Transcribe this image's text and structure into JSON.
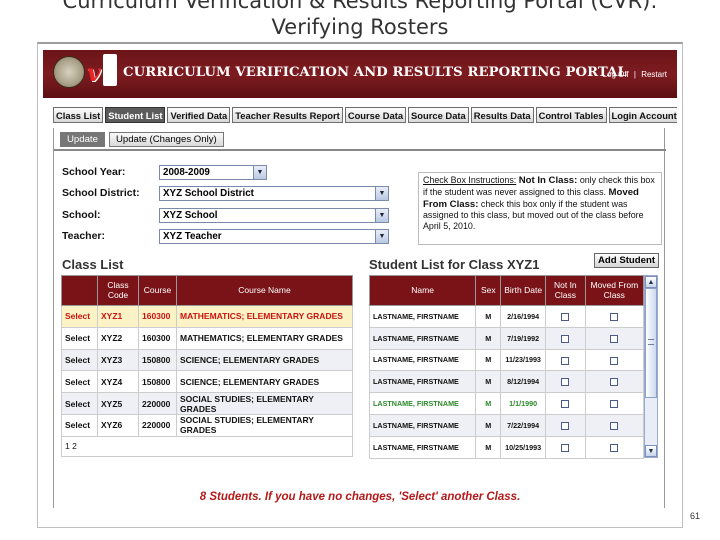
{
  "slide": {
    "title_line1": "Curriculum Verification & Results Reporting Portal (CVR):",
    "title_line2": "Verifying Rosters",
    "page_number": "61"
  },
  "banner": {
    "title": "CURRICULUM VERIFICATION AND RESULTS REPORTING PORTAL",
    "logout": "Log Off",
    "separator": "|",
    "restart": "Restart",
    "logo_icon": "vi-logo-icon",
    "seal_icon": "state-seal-icon"
  },
  "nav_tabs": [
    {
      "label": "Class List",
      "active": false
    },
    {
      "label": "Student List",
      "active": true
    },
    {
      "label": "Verified Data",
      "active": false
    },
    {
      "label": "Teacher Results Report",
      "active": false
    },
    {
      "label": "Course Data",
      "active": false
    },
    {
      "label": "Source Data",
      "active": false
    },
    {
      "label": "Results Data",
      "active": false
    },
    {
      "label": "Control Tables",
      "active": false
    },
    {
      "label": "Login Account",
      "active": false
    }
  ],
  "sub_tabs": [
    {
      "label": "Update",
      "active": true
    },
    {
      "label": "Update (Changes Only)",
      "active": false
    }
  ],
  "filters": {
    "school_year_label": "School Year:",
    "school_year_value": "2008-2009",
    "district_label": "School District:",
    "district_value": "XYZ School District",
    "school_label": "School:",
    "school_value": "XYZ School",
    "teacher_label": "Teacher:",
    "teacher_value": "XYZ Teacher"
  },
  "instructions": {
    "heading": "Check Box Instructions:",
    "not_in_class_term": "Not In Class:",
    "not_in_class_text": "only check this box if the student was never assigned to this class.",
    "moved_term": "Moved From Class:",
    "moved_text": "check this box only if the student was assigned to this class, but moved out of the class before April 5, 2010."
  },
  "class_list": {
    "title": "Class List",
    "columns": [
      "",
      "Class Code",
      "Course",
      "Course Name"
    ],
    "rows": [
      {
        "action": "Select",
        "code": "XYZ1",
        "course": "160300",
        "name": "MATHEMATICS; ELEMENTARY GRADES"
      },
      {
        "action": "Select",
        "code": "XYZ2",
        "course": "160300",
        "name": "MATHEMATICS; ELEMENTARY GRADES"
      },
      {
        "action": "Select",
        "code": "XYZ3",
        "course": "150800",
        "name": "SCIENCE; ELEMENTARY GRADES"
      },
      {
        "action": "Select",
        "code": "XYZ4",
        "course": "150800",
        "name": "SCIENCE; ELEMENTARY GRADES"
      },
      {
        "action": "Select",
        "code": "XYZ5",
        "course": "220000",
        "name": "SOCIAL STUDIES; ELEMENTARY GRADES"
      },
      {
        "action": "Select",
        "code": "XYZ6",
        "course": "220000",
        "name": "SOCIAL STUDIES; ELEMENTARY GRADES"
      }
    ],
    "pager": [
      "1",
      "2"
    ]
  },
  "student_list": {
    "title": "Student List for Class XYZ1",
    "add_button": "Add Student",
    "columns": [
      "Name",
      "Sex",
      "Birth Date",
      "Not In Class",
      "Moved From Class"
    ],
    "rows": [
      {
        "name": "LASTNAME, FIRSTNAME",
        "sex": "M",
        "birth": "2/16/1994"
      },
      {
        "name": "LASTNAME, FIRSTNAME",
        "sex": "M",
        "birth": "7/19/1992"
      },
      {
        "name": "LASTNAME, FIRSTNAME",
        "sex": "M",
        "birth": "11/23/1993"
      },
      {
        "name": "LASTNAME, FIRSTNAME",
        "sex": "M",
        "birth": "8/12/1994"
      },
      {
        "name": "LASTNAME, FIRSTNAME",
        "sex": "M",
        "birth": "1/1/1990"
      },
      {
        "name": "LASTNAME, FIRSTNAME",
        "sex": "M",
        "birth": "7/22/1994"
      },
      {
        "name": "LASTNAME, FIRSTNAME",
        "sex": "M",
        "birth": "10/25/1993"
      }
    ]
  },
  "footer_message": "8 Students.  If you have no changes, 'Select' another Class.",
  "colors": {
    "banner": "#7d1c20",
    "header_bg": "#7a1318",
    "selected_row": "#fbf3c6",
    "highlight_text": "#c11111",
    "green_text": "#2a8a2a"
  }
}
